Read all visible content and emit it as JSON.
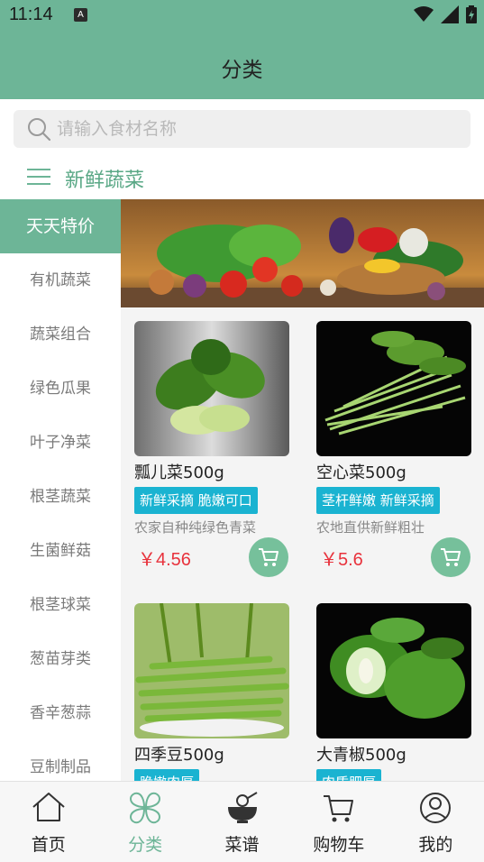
{
  "status_bar": {
    "time": "11:14",
    "badge": "A"
  },
  "header": {
    "title": "分类"
  },
  "search": {
    "placeholder": "请输入食材名称"
  },
  "category": {
    "title": "新鲜蔬菜"
  },
  "sidebar": {
    "items": [
      {
        "label": "天天特价",
        "active": true
      },
      {
        "label": "有机蔬菜"
      },
      {
        "label": "蔬菜组合"
      },
      {
        "label": "绿色瓜果"
      },
      {
        "label": "叶子净菜"
      },
      {
        "label": "根茎蔬菜"
      },
      {
        "label": "生菌鲜菇"
      },
      {
        "label": "根茎球菜"
      },
      {
        "label": "葱苗芽类"
      },
      {
        "label": "香辛葱蒜"
      },
      {
        "label": "豆制制品"
      }
    ]
  },
  "products": [
    {
      "name": "瓢儿菜500g",
      "tag": "新鲜采摘 脆嫩可口",
      "desc": "农家自种纯绿色青菜",
      "price": "￥4.56"
    },
    {
      "name": "空心菜500g",
      "tag": "茎杆鲜嫩 新鲜采摘",
      "desc": "农地直供新鲜粗壮",
      "price": "￥5.6"
    },
    {
      "name": "四季豆500g",
      "tag": "脆嫩肉厚",
      "desc": "",
      "price": ""
    },
    {
      "name": "大青椒500g",
      "tag": "肉质肥厚",
      "desc": "",
      "price": ""
    }
  ],
  "tabbar": {
    "items": [
      {
        "label": "首页",
        "icon": "home-icon"
      },
      {
        "label": "分类",
        "icon": "category-icon",
        "active": true
      },
      {
        "label": "菜谱",
        "icon": "recipe-icon"
      },
      {
        "label": "购物车",
        "icon": "cart-icon"
      },
      {
        "label": "我的",
        "icon": "profile-icon"
      }
    ]
  },
  "colors": {
    "brand": "#6db597",
    "price": "#e8323c",
    "tag": "#1ab3d1"
  }
}
